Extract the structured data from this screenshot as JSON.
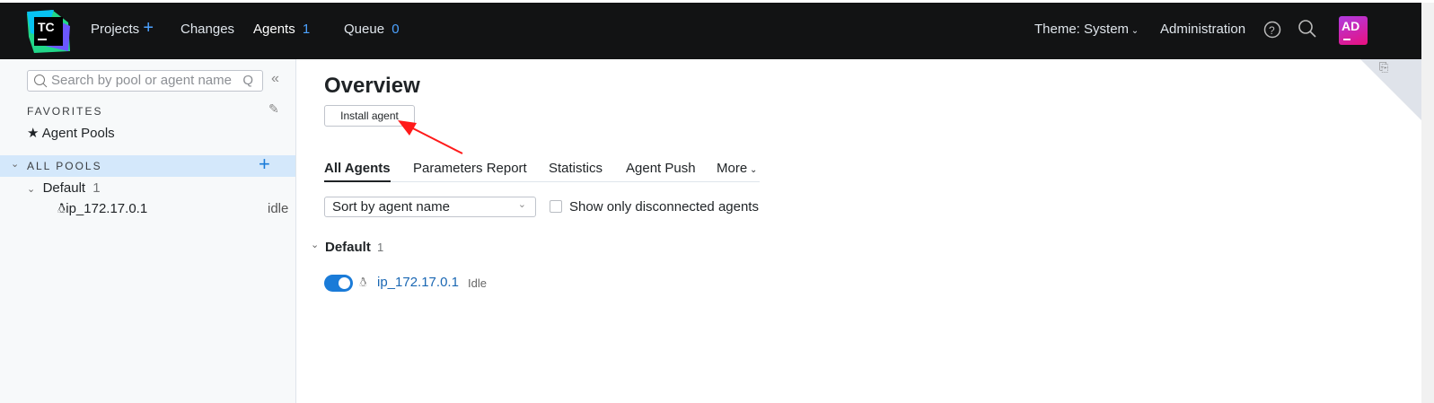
{
  "header": {
    "logo_text": "TC",
    "nav": [
      {
        "label": "Projects"
      },
      {
        "label": "Changes"
      },
      {
        "label": "Agents",
        "count": "1"
      },
      {
        "label": "Queue",
        "count": "0"
      }
    ],
    "theme": "Theme: System",
    "administration": "Administration",
    "avatar": "AD"
  },
  "sidebar": {
    "search_placeholder": "Search by pool or agent name",
    "search_hint": "Q",
    "favorites": "FAVORITES",
    "favorite_item": "Agent Pools",
    "all_pools": "ALL POOLS",
    "pool": {
      "name": "Default",
      "count": "1"
    },
    "agent": {
      "name": "ip_172.17.0.1",
      "status": "idle"
    }
  },
  "main": {
    "title": "Overview",
    "install_button": "Install agent",
    "tabs": [
      "All Agents",
      "Parameters Report",
      "Statistics",
      "Agent Push",
      "More"
    ],
    "sort": "Sort by agent name",
    "checkbox_label": "Show only disconnected agents",
    "group": {
      "name": "Default",
      "count": "1"
    },
    "agent": {
      "name": "ip_172.17.0.1",
      "status": "Idle",
      "enabled": true
    }
  },
  "colors": {
    "header_bg": "#121314",
    "accent": "#4ca2ff",
    "toggle": "#1a7bd8",
    "annotation_arrow": "#ff1a1a"
  }
}
